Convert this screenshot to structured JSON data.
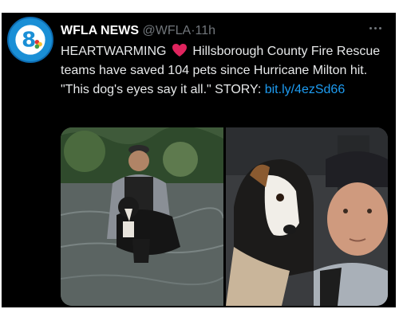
{
  "tweet": {
    "author_name": "WFLA NEWS",
    "author_handle": "@WFLA",
    "separator": "·",
    "time": "11h",
    "text_prefix": "HEARTWARMING",
    "text_body": "Hillsborough County Fire Rescue teams have saved 104 pets since Hurricane Milton hit. \"This dog's eyes say it all.\" STORY:",
    "link": "bit.ly/4ezSd66",
    "avatar_logo": "8"
  },
  "icons": {
    "avatar": "wfla-8-logo-icon",
    "heart": "red-heart-emoji-icon",
    "more": "more-options-icon"
  },
  "colors": {
    "background": "#000000",
    "text": "#e7e9ea",
    "muted": "#71767b",
    "link": "#1d9bf0",
    "heart": "#e0245e",
    "avatar_bg": "#1a8fd6"
  }
}
